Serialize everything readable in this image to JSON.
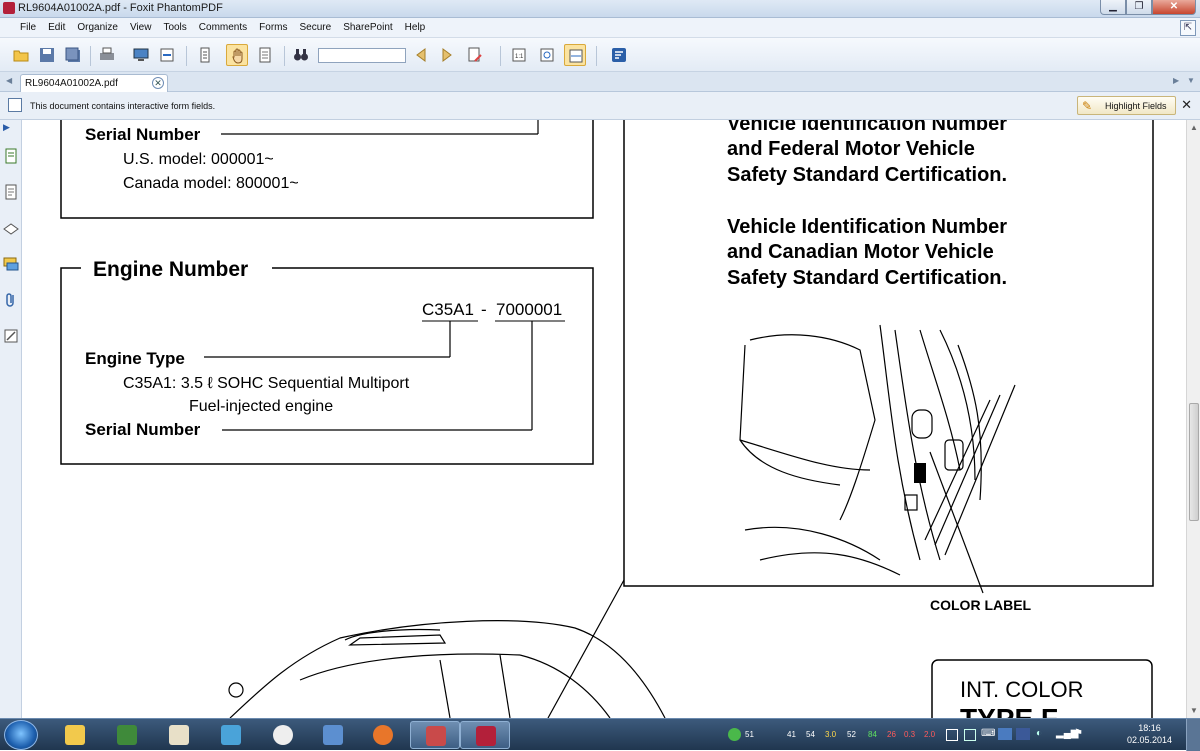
{
  "window": {
    "title": "RL9604A01002A.pdf - Foxit PhantomPDF",
    "minimize": "▁",
    "maximize": "❐",
    "close": "✕"
  },
  "menu": {
    "items": [
      "File",
      "Edit",
      "Organize",
      "View",
      "Tools",
      "Comments",
      "Forms",
      "Secure",
      "SharePoint",
      "Help"
    ],
    "expand_icon": "⇱"
  },
  "toolbar": {
    "search_value": ""
  },
  "tab": {
    "label": "RL9604A01002A.pdf",
    "close": "✕"
  },
  "infobar": {
    "message": "This document contains interactive form fields.",
    "highlight_label": "Highlight Fields",
    "close": "✕"
  },
  "document": {
    "top_box": {
      "serial_label": "Serial Number",
      "us_model": "U.S. model: 000001~",
      "canada_model": "Canada model: 800001~"
    },
    "engine_box": {
      "heading": "Engine Number",
      "code_part1": "C35A1",
      "code_dash": "-",
      "code_part2": "7000001",
      "engine_type_label": "Engine Type",
      "engine_desc_line1": "C35A1: 3.5 ℓ SOHC Sequential Multiport",
      "engine_desc_line2": "Fuel-injected engine",
      "serial_label": "Serial Number"
    },
    "vin_box": {
      "line1": "Vehicle Identification Number",
      "line2": "and Federal Motor Vehicle",
      "line3": "Safety Standard Certification.",
      "line4": "Vehicle Identification Number",
      "line5": "and Canadian Motor Vehicle",
      "line6": "Safety Standard Certification."
    },
    "color_label": "COLOR LABEL",
    "int_color": "INT. COLOR",
    "type_text": "TYPE F"
  },
  "taskbar": {
    "tray_numbers": [
      "51",
      "41",
      "54",
      "3.0",
      "52",
      "84",
      "26",
      "0.3",
      "2.0"
    ],
    "tray_colors": [
      "#ffffff",
      "#ffffff",
      "#ffffff",
      "#ffd84a",
      "#ffffff",
      "#5fe05f",
      "#ff5a5a",
      "#ff5a5a",
      "#ff5a5a"
    ],
    "time": "18:16",
    "date": "02.05.2014"
  }
}
